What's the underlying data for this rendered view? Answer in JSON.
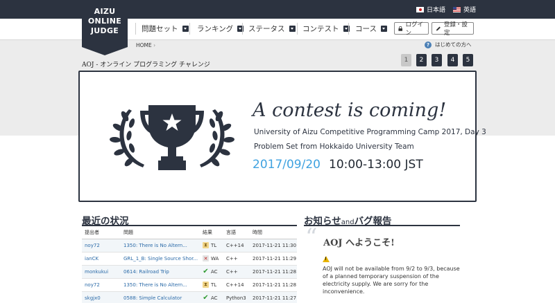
{
  "header": {
    "logo_lines": [
      "AIZU",
      "ONLINE",
      "JUDGE"
    ],
    "languages": [
      {
        "label": "日本語",
        "icon": "flag-jp-icon"
      },
      {
        "label": "英語",
        "icon": "flag-us-icon"
      }
    ]
  },
  "nav": {
    "items": [
      "問題セット",
      "ランキング",
      "ステータス",
      "コンテスト",
      "コース"
    ],
    "login_label": "ログイン",
    "register_label": "登録・設定"
  },
  "breadcrumb": {
    "home": "HOME",
    "help_label": "はじめての方へ"
  },
  "page": {
    "title": "AOJ - オンライン プログラミング チャレンジ"
  },
  "pager": {
    "pages": [
      "1",
      "2",
      "3",
      "4",
      "5"
    ],
    "active": "1"
  },
  "banner": {
    "headline": "A contest is coming!",
    "line1": "University of Aizu Competitive Programming Camp 2017, Day 3",
    "line2": "Problem Set from Hokkaido University Team",
    "date": "2017/09/20",
    "time": "10:00-13:00 JST",
    "icon": "trophy-icon"
  },
  "status": {
    "title": "最近の状況",
    "columns": [
      "提出者",
      "問題",
      "結果",
      "言語",
      "時間"
    ],
    "rows": [
      {
        "user": "noy72",
        "problem": "1350: There is No Altern...",
        "result": "TL",
        "lang": "C++14",
        "time": "2017-11-21 11:30"
      },
      {
        "user": "ianCK",
        "problem": "GRL_1_B: Single Source Shor...",
        "result": "WA",
        "lang": "C++",
        "time": "2017-11-21 11:29"
      },
      {
        "user": "monkukui",
        "problem": "0614: Railroad Trip",
        "result": "AC",
        "lang": "C++",
        "time": "2017-11-21 11:28"
      },
      {
        "user": "noy72",
        "problem": "1350: There is No Altern...",
        "result": "TL",
        "lang": "C++14",
        "time": "2017-11-21 11:28"
      },
      {
        "user": "skgjx0",
        "problem": "0588: Simple Calculator",
        "result": "AC",
        "lang": "Python3",
        "time": "2017-11-21 11:27"
      }
    ]
  },
  "news": {
    "title_main": "お知らせ",
    "title_and": "and",
    "title_rest": "バグ報告",
    "welcome": "AOJ へようこそ!",
    "notice": "AOJ will not be available from 9/2 to 9/3, because of a planned temporary suspension of the electricity supply. We are sorry for the inconvenience."
  },
  "colors": {
    "primary": "#2c3340",
    "accent_blue": "#3fa2e0",
    "link": "#2a6aa8"
  }
}
